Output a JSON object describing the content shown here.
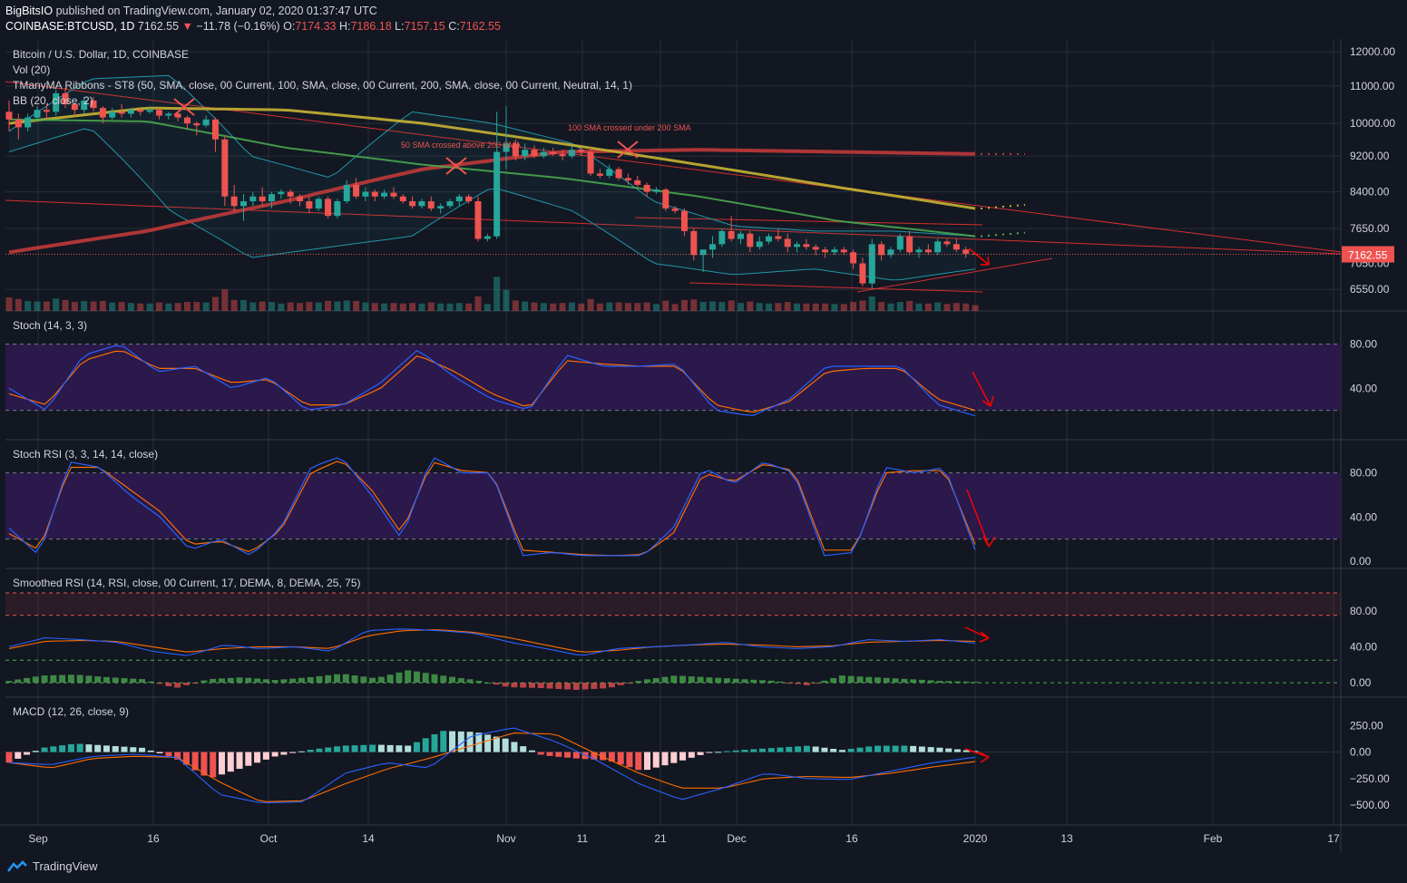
{
  "header": {
    "publisher": "BigBitsIO",
    "published_text": "published on TradingView.com, January 02, 2020 01:37:47 UTC",
    "symbol": "COINBASE:BTCUSD, 1D",
    "last": "7162.55",
    "change": "−11.78 (−0.16%)",
    "o_label": "O:",
    "o_value": "7174.33",
    "h_label": "H:",
    "h_value": "7186.18",
    "l_label": "L:",
    "l_value": "7157.15",
    "c_label": "C:",
    "c_value": "7162.55"
  },
  "colors": {
    "background": "#131722",
    "grid": "#2a2e39",
    "up": "#26a69a",
    "down": "#ef5350",
    "sma50": "#4caf50",
    "sma100": "#c8b432",
    "sma200": "#c0383a",
    "bb": "#2196a8",
    "stoch_k": "#2962ff",
    "stoch_d": "#ff6d00",
    "band_fill": "#2e1a4f",
    "arrow": "#ff0000"
  },
  "panes": {
    "price": {
      "legend": [
        "Bitcoin / U.S. Dollar, 1D, COINBASE",
        "Vol (20)",
        "TManyMA Ribbons - ST8 (50, SMA, close, 00 Current, 100, SMA, close, 00 Current, 200, SMA, close, 00 Current, Neutral, 14, 1)",
        "BB (20, close, 2)"
      ],
      "ticks": [
        "12000.00",
        "11000.00",
        "10000.00",
        "9200.00",
        "8400.00",
        "7650.00",
        "6550.00"
      ],
      "price_tag": "7162.55",
      "price_tag_behind": "7050.00",
      "annotations": [
        "100 SMA crossed under 200 SMA",
        "50 SMA crossed above 200 SMA"
      ]
    },
    "stoch": {
      "legend": "Stoch (14, 3, 3)",
      "ticks": [
        "80.00",
        "40.00"
      ]
    },
    "stochrsi": {
      "legend": "Stoch RSI (3, 3, 14, 14, close)",
      "ticks": [
        "80.00",
        "40.00",
        "0.00"
      ]
    },
    "smoothrsi": {
      "legend": "Smoothed RSI (14, RSI, close, 00 Current, 17, DEMA, 8, DEMA, 25, 75)",
      "ticks": [
        "80.00",
        "40.00",
        "0.00"
      ]
    },
    "macd": {
      "legend": "MACD (12, 26, close, 9)",
      "ticks": [
        "250.00",
        "0.00",
        "−250.00",
        "−500.00"
      ]
    }
  },
  "time_axis": [
    "Sep",
    "16",
    "Oct",
    "14",
    "Nov",
    "11",
    "21",
    "Dec",
    "16",
    "2020",
    "13",
    "Feb",
    "17"
  ],
  "footer": {
    "brand": "TradingView"
  },
  "chart_data": {
    "type": "candlestick",
    "title": "Bitcoin / U.S. Dollar, 1D, COINBASE",
    "last_price": 7162.55,
    "price_range": [
      6200,
      12400
    ],
    "price_log_scale": true,
    "candles_approx": [
      [
        10300,
        10600,
        9800,
        10100
      ],
      [
        10100,
        10250,
        9600,
        9900
      ],
      [
        9900,
        10250,
        9800,
        10150
      ],
      [
        10150,
        10450,
        10050,
        10350
      ],
      [
        10350,
        10500,
        10100,
        10300
      ],
      [
        10300,
        10900,
        10200,
        10800
      ],
      [
        10800,
        10950,
        10400,
        10500
      ],
      [
        10500,
        10550,
        10200,
        10350
      ],
      [
        10350,
        10700,
        10250,
        10600
      ],
      [
        10600,
        10700,
        10300,
        10400
      ],
      [
        10400,
        10450,
        10000,
        10150
      ],
      [
        10150,
        10400,
        10100,
        10300
      ],
      [
        10300,
        10500,
        10150,
        10250
      ],
      [
        10250,
        10400,
        10150,
        10350
      ],
      [
        10350,
        10400,
        10200,
        10300
      ],
      [
        10300,
        10450,
        10250,
        10350
      ],
      [
        10350,
        10400,
        10100,
        10200
      ],
      [
        10200,
        10300,
        10100,
        10250
      ],
      [
        10250,
        10300,
        10050,
        10150
      ],
      [
        10150,
        10200,
        9850,
        10000
      ],
      [
        10000,
        10050,
        9700,
        9950
      ],
      [
        9950,
        10200,
        9900,
        10100
      ],
      [
        10100,
        10150,
        9300,
        9600
      ],
      [
        9600,
        9700,
        8100,
        8300
      ],
      [
        8300,
        8550,
        8000,
        8100
      ],
      [
        8100,
        8350,
        7800,
        8200
      ],
      [
        8200,
        8400,
        8100,
        8300
      ],
      [
        8300,
        8500,
        8100,
        8200
      ],
      [
        8200,
        8400,
        8050,
        8350
      ],
      [
        8350,
        8450,
        8250,
        8400
      ],
      [
        8400,
        8450,
        8150,
        8300
      ],
      [
        8300,
        8350,
        8100,
        8200
      ],
      [
        8200,
        8300,
        7950,
        8050
      ],
      [
        8050,
        8300,
        8000,
        8250
      ],
      [
        8250,
        8300,
        7850,
        7900
      ],
      [
        7900,
        8250,
        7850,
        8200
      ],
      [
        8200,
        8650,
        8150,
        8550
      ],
      [
        8550,
        8700,
        8250,
        8300
      ],
      [
        8300,
        8500,
        8200,
        8400
      ],
      [
        8400,
        8450,
        8200,
        8300
      ],
      [
        8300,
        8450,
        8250,
        8380
      ],
      [
        8380,
        8500,
        8250,
        8300
      ],
      [
        8300,
        8350,
        8150,
        8200
      ],
      [
        8200,
        8300,
        8050,
        8100
      ],
      [
        8100,
        8250,
        8050,
        8200
      ],
      [
        8200,
        8300,
        8000,
        8050
      ],
      [
        8050,
        8150,
        7950,
        8100
      ],
      [
        8100,
        8250,
        8050,
        8200
      ],
      [
        8200,
        8350,
        8100,
        8300
      ],
      [
        8300,
        8350,
        8150,
        8200
      ],
      [
        8200,
        8300,
        7400,
        7450
      ],
      [
        7450,
        7550,
        7400,
        7500
      ],
      [
        7500,
        10300,
        7450,
        9300
      ],
      [
        9300,
        10450,
        8900,
        9500
      ],
      [
        9500,
        9600,
        9100,
        9200
      ],
      [
        9200,
        9500,
        9100,
        9350
      ],
      [
        9350,
        9450,
        9150,
        9200
      ],
      [
        9200,
        9400,
        9150,
        9300
      ],
      [
        9300,
        9400,
        9200,
        9250
      ],
      [
        9250,
        9350,
        9100,
        9200
      ],
      [
        9200,
        9450,
        9150,
        9350
      ],
      [
        9350,
        9400,
        9200,
        9300
      ],
      [
        9300,
        9400,
        8750,
        8800
      ],
      [
        8800,
        8900,
        8700,
        8750
      ],
      [
        8750,
        9000,
        8700,
        8900
      ],
      [
        8900,
        8950,
        8650,
        8700
      ],
      [
        8700,
        8800,
        8550,
        8650
      ],
      [
        8650,
        8750,
        8500,
        8550
      ],
      [
        8550,
        8600,
        8300,
        8400
      ],
      [
        8400,
        8500,
        8350,
        8450
      ],
      [
        8450,
        8480,
        8000,
        8050
      ],
      [
        8050,
        8100,
        7950,
        8000
      ],
      [
        8000,
        8050,
        7500,
        7600
      ],
      [
        7600,
        7650,
        7050,
        7150
      ],
      [
        7150,
        7200,
        6850,
        7250
      ],
      [
        7250,
        7500,
        7100,
        7350
      ],
      [
        7350,
        7650,
        7300,
        7600
      ],
      [
        7600,
        7900,
        7400,
        7450
      ],
      [
        7450,
        7600,
        7350,
        7550
      ],
      [
        7550,
        7600,
        7200,
        7300
      ],
      [
        7300,
        7500,
        7250,
        7400
      ],
      [
        7400,
        7550,
        7350,
        7500
      ],
      [
        7500,
        7650,
        7400,
        7450
      ],
      [
        7450,
        7550,
        7200,
        7300
      ],
      [
        7300,
        7400,
        7200,
        7350
      ],
      [
        7350,
        7450,
        7250,
        7300
      ],
      [
        7300,
        7350,
        7150,
        7250
      ],
      [
        7250,
        7300,
        7100,
        7200
      ],
      [
        7200,
        7300,
        7150,
        7250
      ],
      [
        7250,
        7300,
        7150,
        7200
      ],
      [
        7200,
        7250,
        6900,
        7000
      ],
      [
        7000,
        7100,
        6600,
        6650
      ],
      [
        6650,
        7450,
        6550,
        7350
      ],
      [
        7350,
        7400,
        7050,
        7150
      ],
      [
        7150,
        7300,
        7100,
        7250
      ],
      [
        7250,
        7550,
        7200,
        7500
      ],
      [
        7500,
        7600,
        7150,
        7200
      ],
      [
        7200,
        7300,
        7100,
        7250
      ],
      [
        7250,
        7350,
        7150,
        7200
      ],
      [
        7200,
        7450,
        7150,
        7400
      ],
      [
        7400,
        7450,
        7300,
        7350
      ],
      [
        7350,
        7450,
        7200,
        7250
      ],
      [
        7250,
        7300,
        7100,
        7174
      ],
      [
        7174,
        7186,
        7157,
        7162
      ]
    ],
    "sma": {
      "50": [
        8600,
        8000,
        7400
      ],
      "100": [
        10000,
        9300,
        8100
      ],
      "200": [
        7300,
        9200,
        9200
      ]
    },
    "stoch_k_approx": [
      40,
      20,
      70,
      80,
      55,
      60,
      40,
      50,
      20,
      25,
      45,
      75,
      50,
      30,
      20,
      70,
      60,
      60,
      62,
      20,
      15,
      30,
      60,
      60,
      60,
      25,
      15
    ],
    "stoch_d_approx": [
      35,
      25,
      65,
      75,
      58,
      58,
      45,
      48,
      25,
      25,
      40,
      70,
      55,
      35,
      22,
      65,
      62,
      60,
      60,
      25,
      18,
      28,
      55,
      58,
      58,
      30,
      20
    ]
  }
}
